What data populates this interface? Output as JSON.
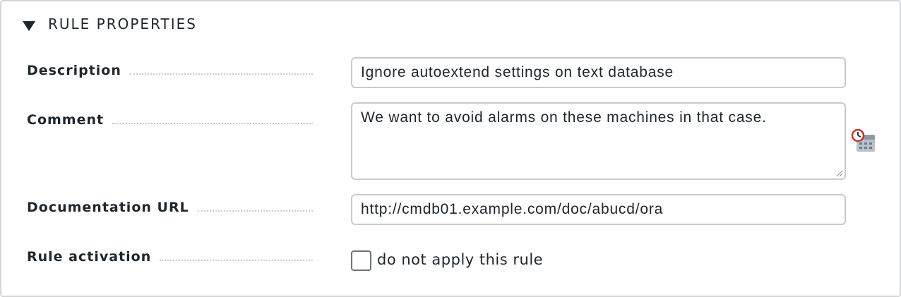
{
  "section": {
    "title": "RULE PROPERTIES",
    "expanded": true
  },
  "fields": {
    "description": {
      "label": "Description",
      "value": "Ignore autoextend settings on text database"
    },
    "comment": {
      "label": "Comment",
      "value": "We want to avoid alarms on these machines in that case.",
      "icon": "calendar-clock-icon"
    },
    "documentation_url": {
      "label": "Documentation URL",
      "value": "http://cmdb01.example.com/doc/abucd/ora"
    },
    "rule_activation": {
      "label": "Rule activation",
      "checkbox_label": "do not apply this rule",
      "checked": false
    }
  },
  "colors": {
    "text": "#1e262e",
    "border": "#c8cbce",
    "icon_accent": "#c0392b"
  }
}
